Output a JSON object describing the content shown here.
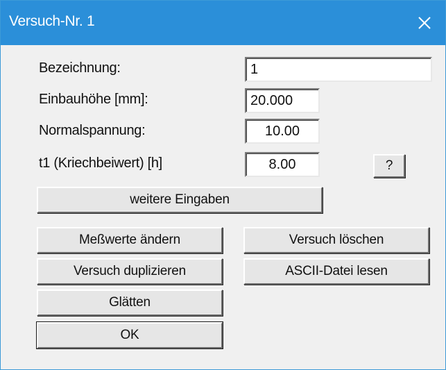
{
  "window": {
    "title": "Versuch-Nr. 1",
    "close_icon": "close-icon"
  },
  "fields": {
    "bezeichnung": {
      "label": "Bezeichnung:",
      "value": "1"
    },
    "einbauhoehe": {
      "label": "Einbauhöhe [mm]:",
      "value": "20.000"
    },
    "normalspannung": {
      "label": "Normalspannung:",
      "value": "10.00"
    },
    "t1": {
      "label": "t1 (Kriechbeiwert) [h]",
      "value": "8.00"
    }
  },
  "buttons": {
    "help": "?",
    "weitere_eingaben": "weitere Eingaben",
    "messwerte_aendern": "Meßwerte ändern",
    "versuch_loeschen": "Versuch löschen",
    "versuch_duplizieren": "Versuch duplizieren",
    "ascii_lesen": "ASCII-Datei lesen",
    "glaetten": "Glätten",
    "ok": "OK"
  },
  "colors": {
    "titlebar": "#2b8fd9",
    "window_bg": "#f0f0f0"
  }
}
